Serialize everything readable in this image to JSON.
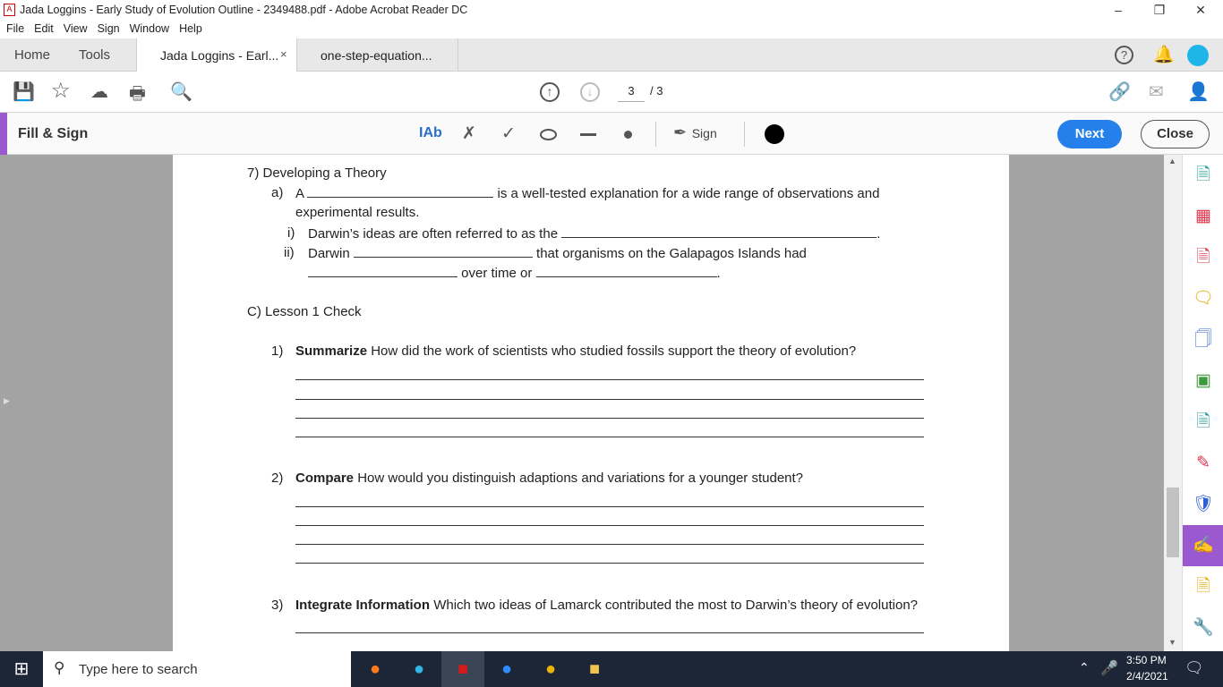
{
  "window": {
    "title": "Jada Loggins - Early Study of Evolution Outline - 2349488.pdf - Adobe Acrobat Reader DC"
  },
  "menu": [
    "File",
    "Edit",
    "View",
    "Sign",
    "Window",
    "Help"
  ],
  "tabs": {
    "home": "Home",
    "tools": "Tools",
    "active": "Jada Loggins - Earl...",
    "second": "one-step-equation..."
  },
  "toolbar": {
    "page_current": "3",
    "page_total": "/ 3"
  },
  "fillsign": {
    "title": "Fill & Sign",
    "text_tool": "IAb",
    "sign": "Sign",
    "next": "Next",
    "close": "Close",
    "accent": "#9b59d0",
    "ink_color": "#000000"
  },
  "doc": {
    "s7": "7)  Developing a Theory",
    "a_label": "a)",
    "a_pre": "A",
    "a_post": "is a well-tested explanation for a wide range of observations and",
    "a_cont": "experimental results.",
    "i_label": "i)",
    "i_text": "Darwin’s ideas are often referred to as the",
    "ii_label": "ii)",
    "ii_pre": "Darwin",
    "ii_post": "that organisms on the Galapagos Islands had",
    "ii_mid": "over time or",
    "c_head": "C)  Lesson 1 Check",
    "q1_num": "1)",
    "q1_bold": "Summarize",
    "q1_text": "How did the work of scientists who studied fossils support the theory of evolution?",
    "q2_num": "2)",
    "q2_bold": "Compare",
    "q2_text": "How would you distinguish adaptions and variations for a younger student?",
    "q3_num": "3)",
    "q3_bold": "Integrate Information",
    "q3_text": "Which two ideas of Lamarck contributed the most to Darwin’s theory of evolution?"
  },
  "taskbar": {
    "search_placeholder": "Type here to search",
    "time": "3:50 PM",
    "date": "2/4/2021"
  }
}
